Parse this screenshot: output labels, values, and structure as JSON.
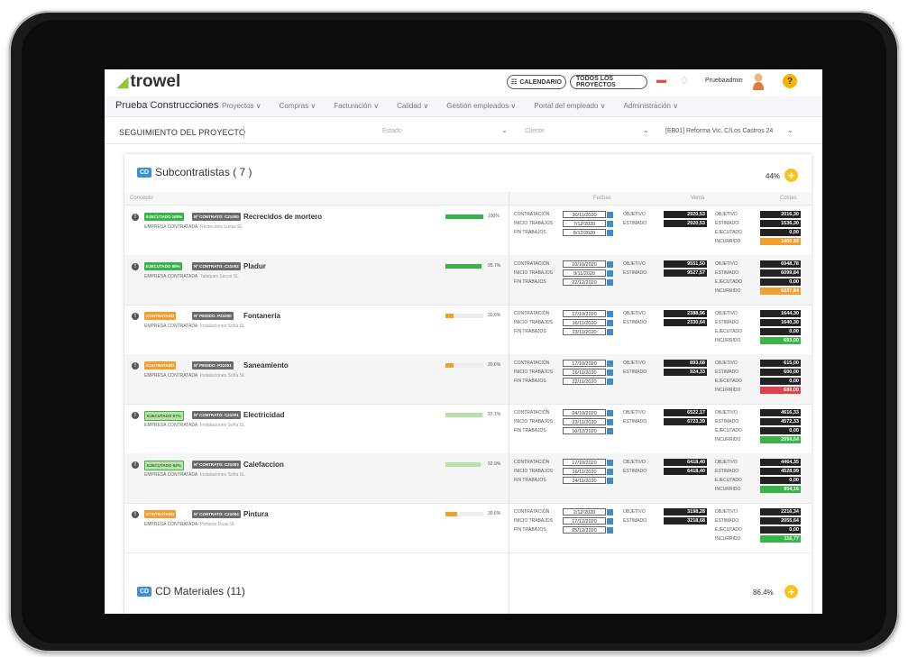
{
  "app": {
    "logo": "trowel",
    "user": "Pruebaadmin",
    "help": "?"
  },
  "topbar": {
    "calendar": "CALENDARIO",
    "all_projects": "TODOS LOS PROYECTOS"
  },
  "nav": {
    "company": "Prueba Construcciones",
    "items": [
      "Proyectos ∨",
      "Compras ∨",
      "Facturación ∨",
      "Calidad ∨",
      "Gestión empleados ∨",
      "Portal del empleado ∨",
      "Administración ∨"
    ]
  },
  "page": {
    "title": "SEGUIMIENTO DEL PROYECTO",
    "filter_status": "Estado",
    "filter_client": "Cliente",
    "project": "[EB01] Reforma Vic. C/Los Castros 24"
  },
  "subcontratistas": {
    "badge": "CD",
    "title": "Subcontratistas",
    "count": "( 7 )",
    "percent": "44%",
    "headers": {
      "concepto": "Concepto",
      "fechas": "Fechas",
      "venta": "Venta",
      "costes": "Costes"
    },
    "labels": {
      "empresa": "EMPRESA CONTRATADA",
      "contratacion": "CONTRATACIÓN",
      "inicio": "INICIO TRABAJOS",
      "fin": "FIN TRABAJOS",
      "objetivo": "OBJETIVO",
      "estimado": "ESTIMADO",
      "ejecutado": "EJECUTADO",
      "incurrido": "INCURRIDO"
    },
    "rows": [
      {
        "status": "EJECUTADO 100%",
        "contract": "Nº CONTRATO: C21000",
        "name": "Recrecidos de mortero",
        "company": "Recrecidos Lucas SL",
        "progress": 100,
        "progress_label": "100%",
        "contratacion": "30/11/2020",
        "inicio": "7/12/2020",
        "fin": "8/12/2020",
        "venta_obj": "2920,53",
        "venta_est": "2920,53",
        "coste_obj": "2016,30",
        "coste_est": "1536,30",
        "coste_ejec": "0,00",
        "coste_inc": "1400,92"
      },
      {
        "status": "EJECUTADO 95%",
        "contract": "Nº CONTRATO: C21002",
        "name": "Pladur",
        "company": "Tabiques Secos SL",
        "progress": 95.7,
        "progress_label": "95.7%",
        "contratacion": "10/10/2020",
        "inicio": "9/11/2020",
        "fin": "22/12/2020",
        "venta_obj": "9551,50",
        "venta_est": "9527,57",
        "coste_obj": "6948,78",
        "coste_est": "6099,84",
        "coste_ejec": "0,00",
        "coste_inc": "6237,84"
      },
      {
        "status": "CONTRATADO",
        "contract": "Nº PEDIDO: P21000",
        "name": "Fontanería",
        "company": "Instalaciones Sofía SL",
        "progress": 20.6,
        "progress_label": "20.6%",
        "contratacion": "17/10/2020",
        "inicio": "16/11/2020",
        "fin": "23/11/2020",
        "venta_obj": "2388,96",
        "venta_est": "2330,64",
        "coste_obj": "1644,30",
        "coste_est": "1640,30",
        "coste_ejec": "0,00",
        "coste_inc": "693,00"
      },
      {
        "status": "CONTRATADO",
        "contract": "Nº PEDIDO: P21001",
        "name": "Saneamiento",
        "company": "Instalaciones Sofía SL",
        "progress": 20.6,
        "progress_label": "20.6%",
        "contratacion": "17/10/2020",
        "inicio": "16/11/2020",
        "fin": "22/11/2020",
        "venta_obj": "893,68",
        "venta_est": "924,33",
        "coste_obj": "615,00",
        "coste_est": "600,00",
        "coste_ejec": "0,00",
        "coste_inc": "680,00"
      },
      {
        "status": "EJECUTADO 97%",
        "contract": "Nº CONTRATO: C21001",
        "name": "Electricidad",
        "company": "Instalaciones Sofía SL",
        "progress": 97.1,
        "progress_label": "97.1%",
        "contratacion": "24/10/2020",
        "inicio": "23/11/2020",
        "fin": "10/12/2020",
        "venta_obj": "6522,17",
        "venta_est": "6723,39",
        "coste_obj": "4616,33",
        "coste_est": "4572,33",
        "coste_ejec": "0,00",
        "coste_inc": "2994,64"
      },
      {
        "status": "EJECUTADO 92%",
        "contract": "Nº CONTRATO: C21003",
        "name": "Calefaccion",
        "company": "Instalaciones Sofía SL",
        "progress": 92.9,
        "progress_label": "92.9%",
        "contratacion": "17/10/2020",
        "inicio": "16/11/2020",
        "fin": "24/11/2020",
        "venta_obj": "6418,40",
        "venta_est": "6418,40",
        "coste_obj": "4464,35",
        "coste_est": "4528,99",
        "coste_ejec": "0,00",
        "coste_inc": "954,16"
      },
      {
        "status": "CONTRATADO",
        "contract": "Nº CONTRATO: C21004",
        "name": "Pintura",
        "company": "Pinturas Duas SL",
        "progress": 30.6,
        "progress_label": "30.6%",
        "contratacion": "2/12/2020",
        "inicio": "17/12/2020",
        "fin": "25/12/2020",
        "venta_obj": "3198,28",
        "venta_est": "3218,68",
        "coste_obj": "2216,34",
        "coste_est": "2055,64",
        "coste_ejec": "0,00",
        "coste_inc": "116,77"
      }
    ]
  },
  "materiales": {
    "badge": "CD",
    "title": "CD Materiales (11)",
    "percent": "86.4%"
  },
  "colors": {
    "green": "#39b34a",
    "light_green": "#b8e0a8",
    "orange": "#f0a030",
    "red": "#e0404a",
    "blue": "#3d8fd8",
    "yellow": "#f7c41f"
  }
}
